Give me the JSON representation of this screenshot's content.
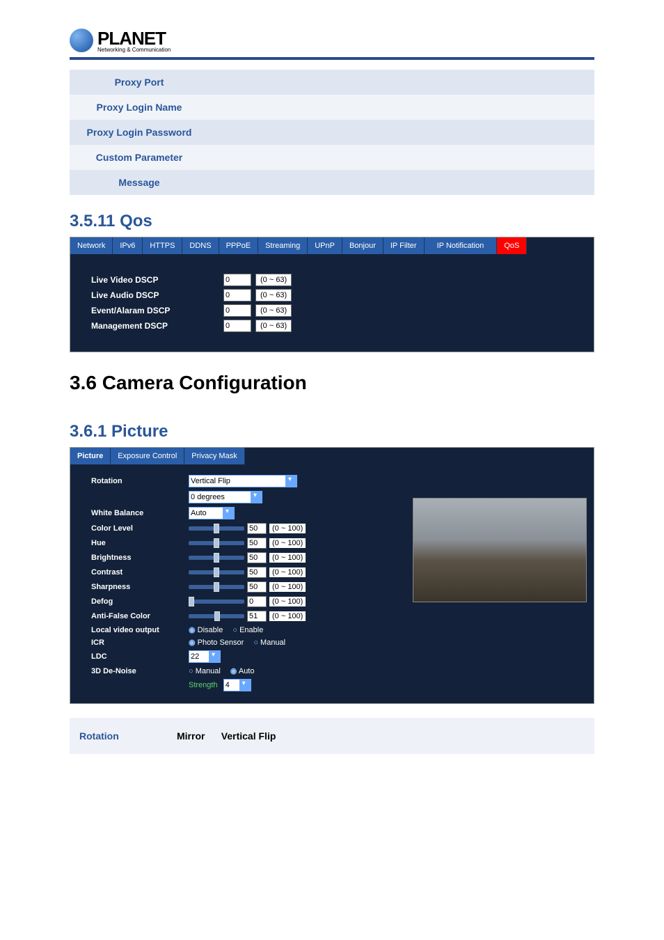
{
  "logo": {
    "brand": "PLANET",
    "tagline": "Networking & Communication"
  },
  "params_table": {
    "rows": [
      {
        "label": "Proxy Port",
        "value": ""
      },
      {
        "label": "Proxy Login Name",
        "value": ""
      },
      {
        "label": "Proxy Login Password",
        "value": ""
      },
      {
        "label": "Custom Parameter",
        "value": ""
      },
      {
        "label": "Message",
        "value": ""
      }
    ]
  },
  "section_qos": "3.5.11 Qos",
  "qos_tabs": [
    "Network",
    "IPv6",
    "HTTPS",
    "DDNS",
    "PPPoE",
    "Streaming",
    "UPnP",
    "Bonjour",
    "IP Filter",
    "IP Notification",
    "QoS"
  ],
  "qos_active_tab": "QoS",
  "qos_rows": [
    {
      "label": "Live Video DSCP",
      "value": "0",
      "range": "(0 ~ 63)"
    },
    {
      "label": "Live Audio DSCP",
      "value": "0",
      "range": "(0 ~ 63)"
    },
    {
      "label": "Event/Alaram DSCP",
      "value": "0",
      "range": "(0 ~ 63)"
    },
    {
      "label": "Management DSCP",
      "value": "0",
      "range": "(0 ~ 63)"
    }
  ],
  "section_camera": "3.6 Camera Configuration",
  "section_picture": "3.6.1 Picture",
  "picture_tabs": [
    "Picture",
    "Exposure Control",
    "Privacy Mask"
  ],
  "picture_active_tab": "Picture",
  "picture": {
    "rotation_label": "Rotation",
    "rotation_select": "Vertical Flip",
    "rotation_degrees": "0 degrees",
    "white_balance_label": "White Balance",
    "white_balance_select": "Auto",
    "sliders": [
      {
        "label": "Color Level",
        "value": "50",
        "range": "(0 ~ 100)",
        "pos": 50
      },
      {
        "label": "Hue",
        "value": "50",
        "range": "(0 ~ 100)",
        "pos": 50
      },
      {
        "label": "Brightness",
        "value": "50",
        "range": "(0 ~ 100)",
        "pos": 50
      },
      {
        "label": "Contrast",
        "value": "50",
        "range": "(0 ~ 100)",
        "pos": 50
      },
      {
        "label": "Sharpness",
        "value": "50",
        "range": "(0 ~ 100)",
        "pos": 50
      },
      {
        "label": "Defog",
        "value": "0",
        "range": "(0 ~ 100)",
        "pos": 0
      },
      {
        "label": "Anti-False Color",
        "value": "51",
        "range": "(0 ~ 100)",
        "pos": 51
      }
    ],
    "local_video_output_label": "Local video output",
    "lvo_disable": "Disable",
    "lvo_enable": "Enable",
    "icr_label": "ICR",
    "icr_photo": "Photo Sensor",
    "icr_manual": "Manual",
    "ldc_label": "LDC",
    "ldc_value": "22",
    "denoise_label": "3D De-Noise",
    "denoise_manual": "Manual",
    "denoise_auto": "Auto",
    "strength_label": "Strength",
    "strength_value": "4"
  },
  "rotation_desc": {
    "label": "Rotation",
    "col1": "Mirror",
    "col2": "Vertical Flip"
  }
}
